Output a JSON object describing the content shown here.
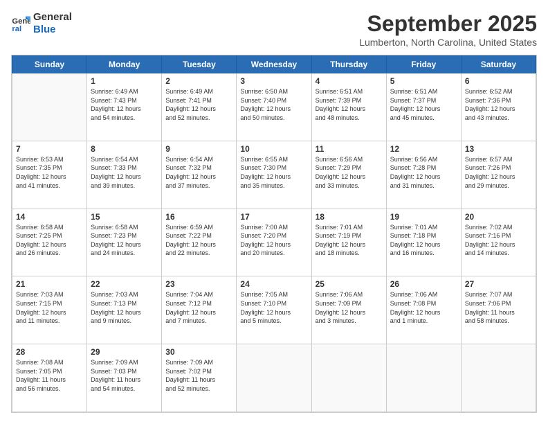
{
  "logo": {
    "line1": "General",
    "line2": "Blue"
  },
  "title": "September 2025",
  "location": "Lumberton, North Carolina, United States",
  "days_of_week": [
    "Sunday",
    "Monday",
    "Tuesday",
    "Wednesday",
    "Thursday",
    "Friday",
    "Saturday"
  ],
  "weeks": [
    [
      {
        "day": "",
        "content": ""
      },
      {
        "day": "1",
        "content": "Sunrise: 6:49 AM\nSunset: 7:43 PM\nDaylight: 12 hours\nand 54 minutes."
      },
      {
        "day": "2",
        "content": "Sunrise: 6:49 AM\nSunset: 7:41 PM\nDaylight: 12 hours\nand 52 minutes."
      },
      {
        "day": "3",
        "content": "Sunrise: 6:50 AM\nSunset: 7:40 PM\nDaylight: 12 hours\nand 50 minutes."
      },
      {
        "day": "4",
        "content": "Sunrise: 6:51 AM\nSunset: 7:39 PM\nDaylight: 12 hours\nand 48 minutes."
      },
      {
        "day": "5",
        "content": "Sunrise: 6:51 AM\nSunset: 7:37 PM\nDaylight: 12 hours\nand 45 minutes."
      },
      {
        "day": "6",
        "content": "Sunrise: 6:52 AM\nSunset: 7:36 PM\nDaylight: 12 hours\nand 43 minutes."
      }
    ],
    [
      {
        "day": "7",
        "content": "Sunrise: 6:53 AM\nSunset: 7:35 PM\nDaylight: 12 hours\nand 41 minutes."
      },
      {
        "day": "8",
        "content": "Sunrise: 6:54 AM\nSunset: 7:33 PM\nDaylight: 12 hours\nand 39 minutes."
      },
      {
        "day": "9",
        "content": "Sunrise: 6:54 AM\nSunset: 7:32 PM\nDaylight: 12 hours\nand 37 minutes."
      },
      {
        "day": "10",
        "content": "Sunrise: 6:55 AM\nSunset: 7:30 PM\nDaylight: 12 hours\nand 35 minutes."
      },
      {
        "day": "11",
        "content": "Sunrise: 6:56 AM\nSunset: 7:29 PM\nDaylight: 12 hours\nand 33 minutes."
      },
      {
        "day": "12",
        "content": "Sunrise: 6:56 AM\nSunset: 7:28 PM\nDaylight: 12 hours\nand 31 minutes."
      },
      {
        "day": "13",
        "content": "Sunrise: 6:57 AM\nSunset: 7:26 PM\nDaylight: 12 hours\nand 29 minutes."
      }
    ],
    [
      {
        "day": "14",
        "content": "Sunrise: 6:58 AM\nSunset: 7:25 PM\nDaylight: 12 hours\nand 26 minutes."
      },
      {
        "day": "15",
        "content": "Sunrise: 6:58 AM\nSunset: 7:23 PM\nDaylight: 12 hours\nand 24 minutes."
      },
      {
        "day": "16",
        "content": "Sunrise: 6:59 AM\nSunset: 7:22 PM\nDaylight: 12 hours\nand 22 minutes."
      },
      {
        "day": "17",
        "content": "Sunrise: 7:00 AM\nSunset: 7:20 PM\nDaylight: 12 hours\nand 20 minutes."
      },
      {
        "day": "18",
        "content": "Sunrise: 7:01 AM\nSunset: 7:19 PM\nDaylight: 12 hours\nand 18 minutes."
      },
      {
        "day": "19",
        "content": "Sunrise: 7:01 AM\nSunset: 7:18 PM\nDaylight: 12 hours\nand 16 minutes."
      },
      {
        "day": "20",
        "content": "Sunrise: 7:02 AM\nSunset: 7:16 PM\nDaylight: 12 hours\nand 14 minutes."
      }
    ],
    [
      {
        "day": "21",
        "content": "Sunrise: 7:03 AM\nSunset: 7:15 PM\nDaylight: 12 hours\nand 11 minutes."
      },
      {
        "day": "22",
        "content": "Sunrise: 7:03 AM\nSunset: 7:13 PM\nDaylight: 12 hours\nand 9 minutes."
      },
      {
        "day": "23",
        "content": "Sunrise: 7:04 AM\nSunset: 7:12 PM\nDaylight: 12 hours\nand 7 minutes."
      },
      {
        "day": "24",
        "content": "Sunrise: 7:05 AM\nSunset: 7:10 PM\nDaylight: 12 hours\nand 5 minutes."
      },
      {
        "day": "25",
        "content": "Sunrise: 7:06 AM\nSunset: 7:09 PM\nDaylight: 12 hours\nand 3 minutes."
      },
      {
        "day": "26",
        "content": "Sunrise: 7:06 AM\nSunset: 7:08 PM\nDaylight: 12 hours\nand 1 minute."
      },
      {
        "day": "27",
        "content": "Sunrise: 7:07 AM\nSunset: 7:06 PM\nDaylight: 11 hours\nand 58 minutes."
      }
    ],
    [
      {
        "day": "28",
        "content": "Sunrise: 7:08 AM\nSunset: 7:05 PM\nDaylight: 11 hours\nand 56 minutes."
      },
      {
        "day": "29",
        "content": "Sunrise: 7:09 AM\nSunset: 7:03 PM\nDaylight: 11 hours\nand 54 minutes."
      },
      {
        "day": "30",
        "content": "Sunrise: 7:09 AM\nSunset: 7:02 PM\nDaylight: 11 hours\nand 52 minutes."
      },
      {
        "day": "",
        "content": ""
      },
      {
        "day": "",
        "content": ""
      },
      {
        "day": "",
        "content": ""
      },
      {
        "day": "",
        "content": ""
      }
    ]
  ]
}
